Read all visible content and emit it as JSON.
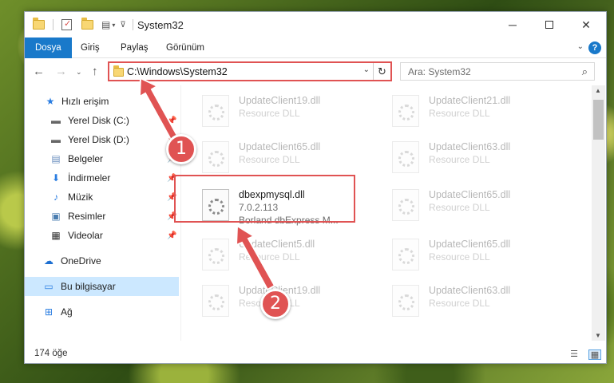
{
  "window": {
    "title": "System32",
    "controls": {
      "minimize_icon": "minimize-icon",
      "maximize_icon": "maximize-icon",
      "close_icon": "close-icon"
    }
  },
  "ribbon": {
    "tabs": [
      "Dosya",
      "Giriş",
      "Paylaş",
      "Görünüm"
    ],
    "active_tab": "Dosya",
    "accent_color": "#1979ca",
    "help_label": "?"
  },
  "address": {
    "path": "C:\\Windows\\System32",
    "search_placeholder": "Ara: System32"
  },
  "sidebar": {
    "items": [
      {
        "label": "Hızlı erişim",
        "icon": "star-icon",
        "pinned": false
      },
      {
        "label": "Yerel Disk (C:)",
        "icon": "drive-icon",
        "pinned": true
      },
      {
        "label": "Yerel Disk (D:)",
        "icon": "drive-icon",
        "pinned": true
      },
      {
        "label": "Belgeler",
        "icon": "documents-icon",
        "pinned": true
      },
      {
        "label": "İndirmeler",
        "icon": "download-icon",
        "pinned": true
      },
      {
        "label": "Müzik",
        "icon": "music-icon",
        "pinned": true
      },
      {
        "label": "Resimler",
        "icon": "pictures-icon",
        "pinned": true
      },
      {
        "label": "Videolar",
        "icon": "videos-icon",
        "pinned": true
      },
      {
        "label": "OneDrive",
        "icon": "cloud-icon",
        "pinned": false
      },
      {
        "label": "Bu bilgisayar",
        "icon": "computer-icon",
        "pinned": false,
        "selected": true
      },
      {
        "label": "Ağ",
        "icon": "network-icon",
        "pinned": false
      }
    ]
  },
  "files": {
    "left_column": [
      {
        "name": "UpdateClient19.dll",
        "line2": "Resource DLL",
        "faded": true
      },
      {
        "name": "UpdateClient65.dll",
        "line2": "Resource DLL",
        "faded": true
      },
      {
        "name": "dbexpmysql.dll",
        "line2": "7.0.2.113",
        "line3": "Borland dbExpress M...",
        "faded": false
      },
      {
        "name": "UpdateClient5.dll",
        "line2": "Resource DLL",
        "faded": true
      },
      {
        "name": "UpdateClient19.dll",
        "line2": "Resource DLL",
        "faded": true
      }
    ],
    "right_column": [
      {
        "name": "UpdateClient21.dll",
        "line2": "Resource DLL",
        "faded": true
      },
      {
        "name": "UpdateClient63.dll",
        "line2": "Resource DLL",
        "faded": true
      },
      {
        "name": "UpdateClient65.dll",
        "line2": "Resource DLL",
        "faded": true
      },
      {
        "name": "UpdateClient65.dll",
        "line2": "Resource DLL",
        "faded": true
      },
      {
        "name": "UpdateClient63.dll",
        "line2": "Resource DLL",
        "faded": true
      }
    ]
  },
  "status": {
    "item_count": "174 öğe"
  },
  "annotations": {
    "color": "#e05353",
    "step1": "1",
    "step2": "2"
  }
}
